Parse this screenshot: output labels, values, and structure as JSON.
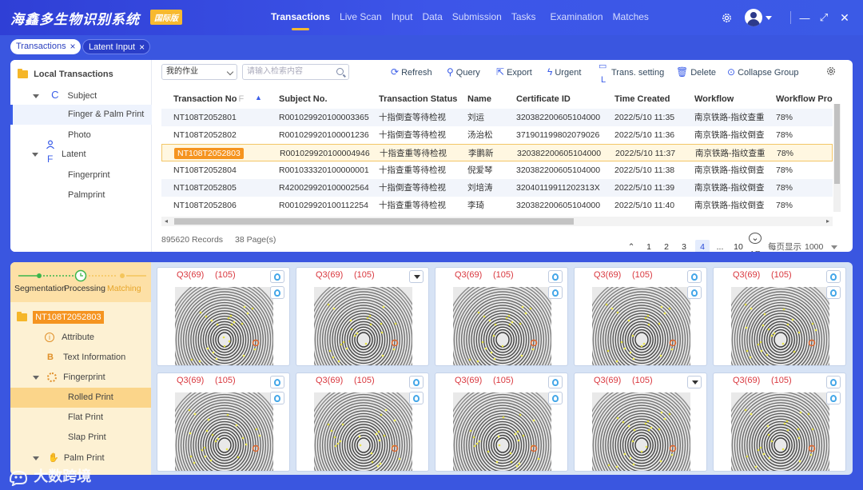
{
  "app": {
    "title": "海鑫多生物识别系统",
    "badge": "国际版"
  },
  "nav": [
    "Transactions",
    "Live Scan",
    "Input",
    "Data",
    "Submission",
    "Tasks",
    "Examination",
    "Matches"
  ],
  "window": {
    "minimize": "—",
    "maximize": "⤢",
    "close": "✕"
  },
  "tabs": [
    {
      "label": "Transactions"
    },
    {
      "label": "Latent Input"
    }
  ],
  "tree": {
    "root": "Local Transactions",
    "subject": {
      "letter": "C",
      "label": "Subject"
    },
    "finger_palm": "Finger & Palm Print",
    "photo": "Photo",
    "latent": {
      "letter": "F",
      "label": "Latent"
    },
    "fingerprint": "Fingerprint",
    "palmprint": "Palmprint"
  },
  "toolbar": {
    "job_select": "我的作业",
    "search_placeholder": "请输入检索内容",
    "refresh": "Refresh",
    "query": "Query",
    "export": "Export",
    "urgent": "Urgent",
    "trans_setting": "Trans. setting",
    "trans_letter": "L",
    "delete": "Delete",
    "collapse": "Collapse Group"
  },
  "table": {
    "columns": [
      "Transaction No",
      "Subject No.",
      "Transaction Status",
      "Name",
      "Certificate ID",
      "Time Created",
      "Workflow",
      "Workflow Pro"
    ],
    "col_suffix": "F",
    "rows": [
      [
        "NT108T2052801",
        "R001029920100003365",
        "十指倒查等待检视",
        "刘运",
        "320382200605104000",
        "2022/5/10  11:35",
        "南京铁路-指纹查重",
        "78%"
      ],
      [
        "NT108T2052802",
        "R001029920100001236",
        "十指倒查等待检视",
        "汤治松",
        "371901199802079026",
        "2022/5/10  11:36",
        "南京铁路-指纹倒查",
        "78%"
      ],
      [
        "NT108T2052803",
        "R001029920100004946",
        "十指查重等待检视",
        "李鹏新",
        "320382200605104000",
        "2022/5/10  11:37",
        "南京铁路-指纹查重",
        "78%"
      ],
      [
        "NT108T2052804",
        "R001033320100000001",
        "十指查重等待检视",
        "倪爱琴",
        "320382200605104000",
        "2022/5/10  11:38",
        "南京铁路-指纹倒查",
        "78%"
      ],
      [
        "NT108T2052805",
        "R420029920100002564",
        "十指倒查等待检视",
        "刘培涛",
        "32040119911202313X",
        "2022/5/10  11:39",
        "南京铁路-指纹倒查",
        "78%"
      ],
      [
        "NT108T2052806",
        "R001029920100112254",
        "十指查重等待检视",
        "李琦",
        "320382200605104000",
        "2022/5/10  11:40",
        "南京铁路-指纹倒查",
        "78%"
      ]
    ],
    "highlight_row": 2
  },
  "footer": {
    "records": "895620 Records",
    "pages": "38 Page(s)",
    "pager": [
      "1",
      "2",
      "3",
      "4",
      "...",
      "10"
    ],
    "current_page": "4",
    "ar": "AR",
    "per_page_label": "每页显示",
    "per_page_value": "1000"
  },
  "steps": [
    {
      "label": "Segmentation",
      "state": "done"
    },
    {
      "label": "Processing",
      "state": "current"
    },
    {
      "label": "Matching",
      "state": "pending"
    }
  ],
  "detail_tree": {
    "case_no": "NT108T2052803",
    "attribute": "Attribute",
    "text_letter": "B",
    "text_info": "Text Information",
    "fingerprint": "Fingerprint",
    "rolled": "Rolled Print",
    "flat": "Flat Print",
    "slap": "Slap Print",
    "palm": "Palm Print"
  },
  "prints": [
    {
      "q": "Q3(69)",
      "n": "(105)",
      "dropdown": false
    },
    {
      "q": "Q3(69)",
      "n": "(105)",
      "dropdown": true
    },
    {
      "q": "Q3(69)",
      "n": "(105)",
      "dropdown": false
    },
    {
      "q": "Q3(69)",
      "n": "(105)",
      "dropdown": false
    },
    {
      "q": "Q3(69)",
      "n": "(105)",
      "dropdown": false
    },
    {
      "q": "Q3(69)",
      "n": "(105)",
      "dropdown": false
    },
    {
      "q": "Q3(69)",
      "n": "(105)",
      "dropdown": false
    },
    {
      "q": "Q3(69)",
      "n": "(105)",
      "dropdown": false
    },
    {
      "q": "Q3(69)",
      "n": "(105)",
      "dropdown": true
    },
    {
      "q": "Q3(69)",
      "n": "(105)",
      "dropdown": false
    }
  ],
  "watermark": "大数跨境",
  "colors": {
    "primary": "#3a5de8",
    "accent": "#f7b92f",
    "highlight": "#f59420",
    "step_green": "#3bb54a"
  }
}
